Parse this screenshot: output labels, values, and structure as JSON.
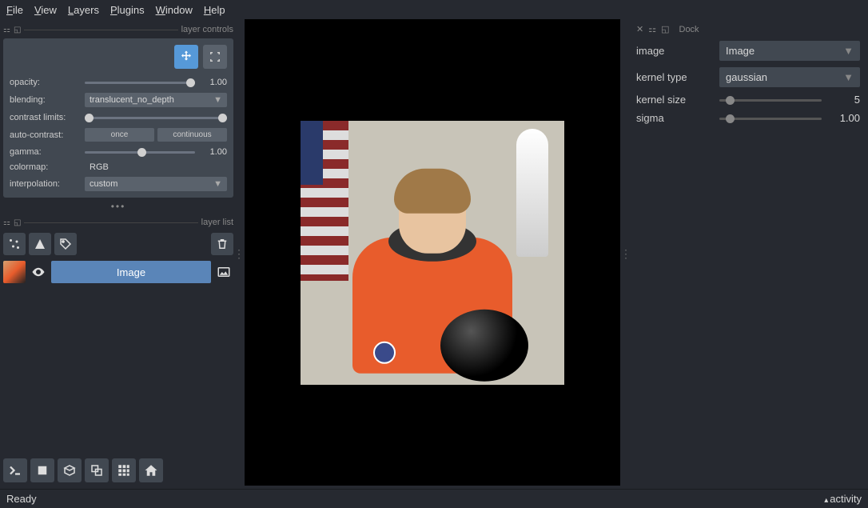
{
  "menu": {
    "file": "File",
    "view": "View",
    "layers": "Layers",
    "plugins": "Plugins",
    "window": "Window",
    "help": "Help"
  },
  "panels": {
    "layer_controls": "layer controls",
    "layer_list": "layer list",
    "dock": "Dock"
  },
  "controls": {
    "opacity_label": "opacity:",
    "opacity_value": "1.00",
    "blending_label": "blending:",
    "blending_value": "translucent_no_depth",
    "contrast_label": "contrast limits:",
    "autocontrast_label": "auto-contrast:",
    "once": "once",
    "continuous": "continuous",
    "gamma_label": "gamma:",
    "gamma_value": "1.00",
    "colormap_label": "colormap:",
    "colormap_value": "RGB",
    "interpolation_label": "interpolation:",
    "interpolation_value": "custom"
  },
  "layer": {
    "name": "Image"
  },
  "widget": {
    "image_label": "image",
    "image_value": "Image",
    "kernel_type_label": "kernel type",
    "kernel_type_value": "gaussian",
    "kernel_size_label": "kernel size",
    "kernel_size_value": "5",
    "sigma_label": "sigma",
    "sigma_value": "1.00"
  },
  "status": {
    "ready": "Ready",
    "activity": "activity"
  }
}
